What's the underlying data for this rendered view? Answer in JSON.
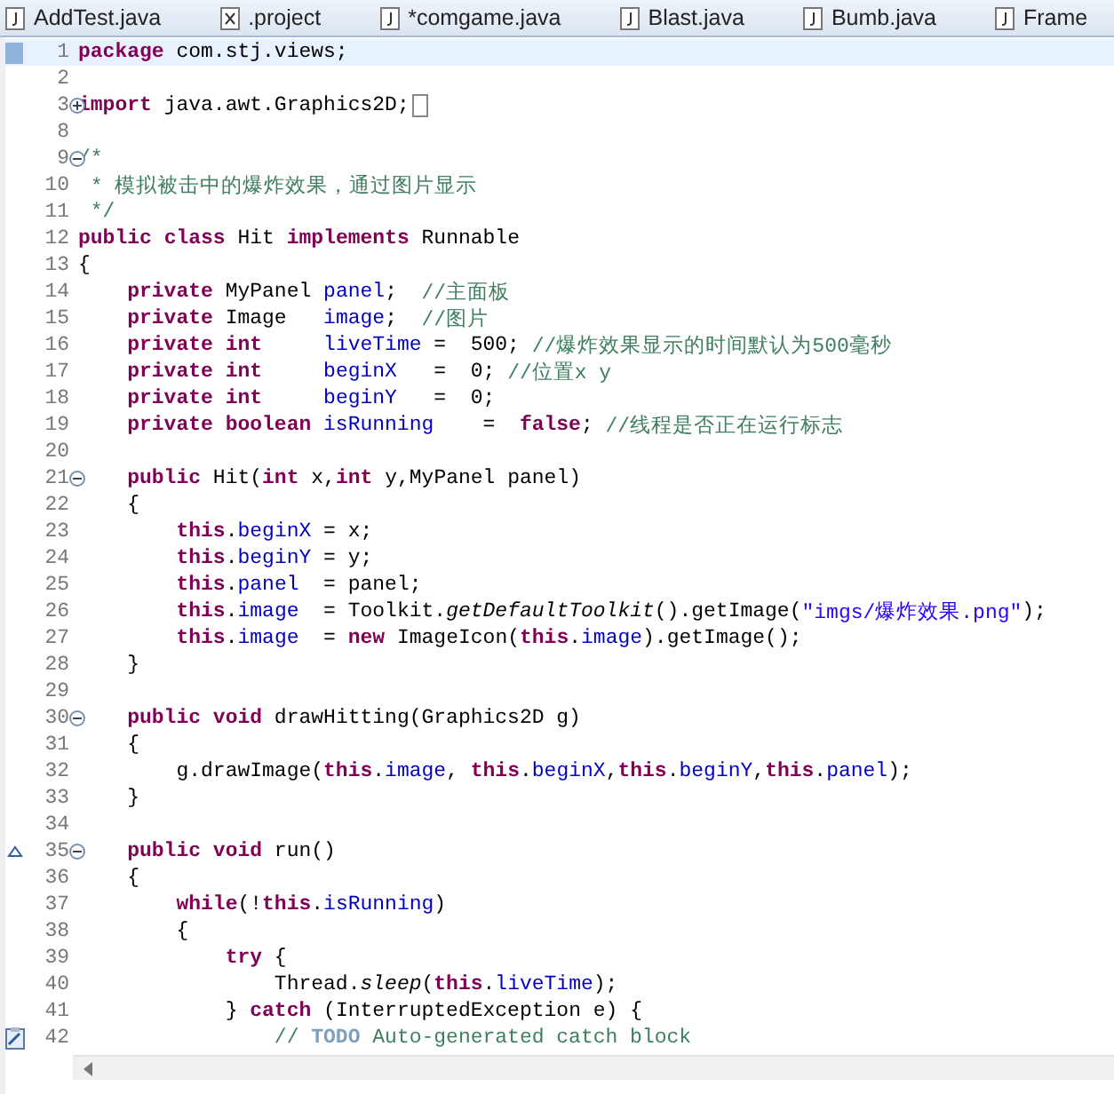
{
  "tabs": [
    {
      "label": "AddTest.java",
      "kind": "java"
    },
    {
      "label": ".project",
      "kind": "xml"
    },
    {
      "label": "*comgame.java",
      "kind": "java"
    },
    {
      "label": "Blast.java",
      "kind": "java"
    },
    {
      "label": "Bumb.java",
      "kind": "java"
    },
    {
      "label": "Frame",
      "kind": "java"
    }
  ],
  "lines": [
    {
      "number": "1",
      "current": true,
      "occurrence": true,
      "tokens": [
        {
          "kind": "keyword",
          "text": "package"
        },
        {
          "kind": "plain",
          "text": " com.stj.views;"
        }
      ]
    },
    {
      "number": "2",
      "current": false
    },
    {
      "number": "3",
      "current": false,
      "fold_expanded": false,
      "tokens": [
        {
          "kind": "keyword",
          "text": "import"
        },
        {
          "kind": "plain",
          "text": " java.awt.Graphics2D;"
        }
      ]
    },
    {
      "number": "8",
      "current": false
    },
    {
      "number": "9",
      "current": false,
      "fold_expanded": true,
      "tokens": [
        {
          "kind": "comment",
          "text": "/*"
        }
      ]
    },
    {
      "number": "10",
      "current": false,
      "tokens": [
        {
          "kind": "comment",
          "text": " * 模拟被击中的爆炸效果，通过图片显示"
        }
      ]
    },
    {
      "number": "11",
      "current": false,
      "tokens": [
        {
          "kind": "comment",
          "text": " */"
        }
      ]
    },
    {
      "number": "12",
      "current": false,
      "tokens": [
        {
          "kind": "keyword",
          "text": "public"
        },
        {
          "kind": "keyword",
          "text": " class"
        },
        {
          "kind": "plain",
          "text": " Hit "
        },
        {
          "kind": "keyword",
          "text": "implements"
        },
        {
          "kind": "plain",
          "text": " Runnable"
        }
      ]
    },
    {
      "number": "13",
      "current": false,
      "tokens": [
        {
          "kind": "plain",
          "text": "{"
        }
      ]
    },
    {
      "number": "14",
      "current": false,
      "tokens": [
        {
          "kind": "keyword",
          "text": "    private"
        },
        {
          "kind": "plain",
          "text": " MyPanel "
        },
        {
          "kind": "field",
          "text": "panel"
        },
        {
          "kind": "plain",
          "text": ";  "
        },
        {
          "kind": "comment",
          "text": "//主面板"
        }
      ]
    },
    {
      "number": "15",
      "current": false,
      "tokens": [
        {
          "kind": "keyword",
          "text": "    private"
        },
        {
          "kind": "plain",
          "text": " Image   "
        },
        {
          "kind": "field",
          "text": "image"
        },
        {
          "kind": "plain",
          "text": ";  "
        },
        {
          "kind": "comment",
          "text": "//图片"
        }
      ]
    },
    {
      "number": "16",
      "current": false,
      "tokens": [
        {
          "kind": "keyword",
          "text": "    private int"
        },
        {
          "kind": "field",
          "text": "     liveTime"
        },
        {
          "kind": "plain",
          "text": " =  500; "
        },
        {
          "kind": "comment",
          "text": "//爆炸效果显示的时间默认为500毫秒"
        }
      ]
    },
    {
      "number": "17",
      "current": false,
      "tokens": [
        {
          "kind": "keyword",
          "text": "    private int"
        },
        {
          "kind": "field",
          "text": "     beginX"
        },
        {
          "kind": "plain",
          "text": "   =  0; "
        },
        {
          "kind": "comment",
          "text": "//位置x y"
        }
      ]
    },
    {
      "number": "18",
      "current": false,
      "tokens": [
        {
          "kind": "keyword",
          "text": "    private int"
        },
        {
          "kind": "field",
          "text": "     beginY"
        },
        {
          "kind": "plain",
          "text": "   =  0;"
        }
      ]
    },
    {
      "number": "19",
      "current": false,
      "tokens": [
        {
          "kind": "keyword",
          "text": "    private boolean"
        },
        {
          "kind": "field",
          "text": " isRunning"
        },
        {
          "kind": "plain",
          "text": "    =  "
        },
        {
          "kind": "keyword",
          "text": "false"
        },
        {
          "kind": "plain",
          "text": "; "
        },
        {
          "kind": "comment",
          "text": "//线程是否正在运行标志"
        }
      ]
    },
    {
      "number": "20",
      "current": false
    },
    {
      "number": "21",
      "current": false,
      "fold_expanded": true,
      "tokens": [
        {
          "kind": "keyword",
          "text": "    public"
        },
        {
          "kind": "plain",
          "text": " Hit("
        },
        {
          "kind": "keyword",
          "text": "int"
        },
        {
          "kind": "plain",
          "text": " x,"
        },
        {
          "kind": "keyword",
          "text": "int"
        },
        {
          "kind": "plain",
          "text": " y,MyPanel panel)"
        }
      ]
    },
    {
      "number": "22",
      "current": false,
      "tokens": [
        {
          "kind": "plain",
          "text": "    {"
        }
      ]
    },
    {
      "number": "23",
      "current": false,
      "tokens": [
        {
          "kind": "keyword",
          "text": "        this"
        },
        {
          "kind": "plain",
          "text": "."
        },
        {
          "kind": "field",
          "text": "beginX"
        },
        {
          "kind": "plain",
          "text": " = x;"
        }
      ]
    },
    {
      "number": "24",
      "current": false,
      "tokens": [
        {
          "kind": "keyword",
          "text": "        this"
        },
        {
          "kind": "plain",
          "text": "."
        },
        {
          "kind": "field",
          "text": "beginY"
        },
        {
          "kind": "plain",
          "text": " = y;"
        }
      ]
    },
    {
      "number": "25",
      "current": false,
      "tokens": [
        {
          "kind": "keyword",
          "text": "        this"
        },
        {
          "kind": "plain",
          "text": "."
        },
        {
          "kind": "field",
          "text": "panel"
        },
        {
          "kind": "plain",
          "text": "  = panel;"
        }
      ]
    },
    {
      "number": "26",
      "current": false,
      "tokens": [
        {
          "kind": "keyword",
          "text": "        this"
        },
        {
          "kind": "plain",
          "text": "."
        },
        {
          "kind": "field",
          "text": "image"
        },
        {
          "kind": "plain",
          "text": "  = Toolkit."
        },
        {
          "kind": "static",
          "text": "getDefaultToolkit"
        },
        {
          "kind": "plain",
          "text": "().getImage("
        },
        {
          "kind": "string",
          "text": "\"imgs/爆炸效果.png\""
        },
        {
          "kind": "plain",
          "text": ");"
        }
      ]
    },
    {
      "number": "27",
      "current": false,
      "tokens": [
        {
          "kind": "keyword",
          "text": "        this"
        },
        {
          "kind": "plain",
          "text": "."
        },
        {
          "kind": "field",
          "text": "image"
        },
        {
          "kind": "plain",
          "text": "  = "
        },
        {
          "kind": "keyword",
          "text": "new"
        },
        {
          "kind": "plain",
          "text": " ImageIcon("
        },
        {
          "kind": "keyword",
          "text": "this"
        },
        {
          "kind": "plain",
          "text": "."
        },
        {
          "kind": "field",
          "text": "image"
        },
        {
          "kind": "plain",
          "text": ").getImage();"
        }
      ]
    },
    {
      "number": "28",
      "current": false,
      "tokens": [
        {
          "kind": "plain",
          "text": "    }"
        }
      ]
    },
    {
      "number": "29",
      "current": false
    },
    {
      "number": "30",
      "current": false,
      "fold_expanded": true,
      "tokens": [
        {
          "kind": "keyword",
          "text": "    public void"
        },
        {
          "kind": "plain",
          "text": " drawHitting(Graphics2D g)"
        }
      ]
    },
    {
      "number": "31",
      "current": false,
      "tokens": [
        {
          "kind": "plain",
          "text": "    {"
        }
      ]
    },
    {
      "number": "32",
      "current": false,
      "tokens": [
        {
          "kind": "plain",
          "text": "        g.drawImage("
        },
        {
          "kind": "keyword",
          "text": "this"
        },
        {
          "kind": "plain",
          "text": "."
        },
        {
          "kind": "field",
          "text": "image"
        },
        {
          "kind": "plain",
          "text": ", "
        },
        {
          "kind": "keyword",
          "text": "this"
        },
        {
          "kind": "plain",
          "text": "."
        },
        {
          "kind": "field",
          "text": "beginX"
        },
        {
          "kind": "plain",
          "text": ","
        },
        {
          "kind": "keyword",
          "text": "this"
        },
        {
          "kind": "plain",
          "text": "."
        },
        {
          "kind": "field",
          "text": "beginY"
        },
        {
          "kind": "plain",
          "text": ","
        },
        {
          "kind": "keyword",
          "text": "this"
        },
        {
          "kind": "plain",
          "text": "."
        },
        {
          "kind": "field",
          "text": "panel"
        },
        {
          "kind": "plain",
          "text": ");"
        }
      ]
    },
    {
      "number": "33",
      "current": false,
      "tokens": [
        {
          "kind": "plain",
          "text": "    }"
        }
      ]
    },
    {
      "number": "34",
      "current": false
    },
    {
      "number": "35",
      "current": false,
      "override": true,
      "fold_expanded": true,
      "tokens": [
        {
          "kind": "keyword",
          "text": "    public void"
        },
        {
          "kind": "plain",
          "text": " run()"
        }
      ]
    },
    {
      "number": "36",
      "current": false,
      "tokens": [
        {
          "kind": "plain",
          "text": "    {"
        }
      ]
    },
    {
      "number": "37",
      "current": false,
      "tokens": [
        {
          "kind": "keyword",
          "text": "        while"
        },
        {
          "kind": "plain",
          "text": "(!"
        },
        {
          "kind": "keyword",
          "text": "this"
        },
        {
          "kind": "plain",
          "text": "."
        },
        {
          "kind": "field",
          "text": "isRunning"
        },
        {
          "kind": "plain",
          "text": ")"
        }
      ]
    },
    {
      "number": "38",
      "current": false,
      "tokens": [
        {
          "kind": "plain",
          "text": "        {"
        }
      ]
    },
    {
      "number": "39",
      "current": false,
      "tokens": [
        {
          "kind": "keyword",
          "text": "            try"
        },
        {
          "kind": "plain",
          "text": " {"
        }
      ]
    },
    {
      "number": "40",
      "current": false,
      "tokens": [
        {
          "kind": "plain",
          "text": "                Thread."
        },
        {
          "kind": "static",
          "text": "sleep"
        },
        {
          "kind": "plain",
          "text": "("
        },
        {
          "kind": "keyword",
          "text": "this"
        },
        {
          "kind": "plain",
          "text": "."
        },
        {
          "kind": "field",
          "text": "liveTime"
        },
        {
          "kind": "plain",
          "text": ");"
        }
      ]
    },
    {
      "number": "41",
      "current": false,
      "tokens": [
        {
          "kind": "plain",
          "text": "            } "
        },
        {
          "kind": "keyword",
          "text": "catch"
        },
        {
          "kind": "plain",
          "text": " (InterruptedException e) {"
        }
      ]
    },
    {
      "number": "42",
      "current": false,
      "task": true,
      "tokens": [
        {
          "kind": "comment",
          "text": "                // "
        },
        {
          "kind": "todo",
          "text": "TODO"
        },
        {
          "kind": "comment",
          "text": " Auto-generated catch block"
        }
      ]
    }
  ]
}
